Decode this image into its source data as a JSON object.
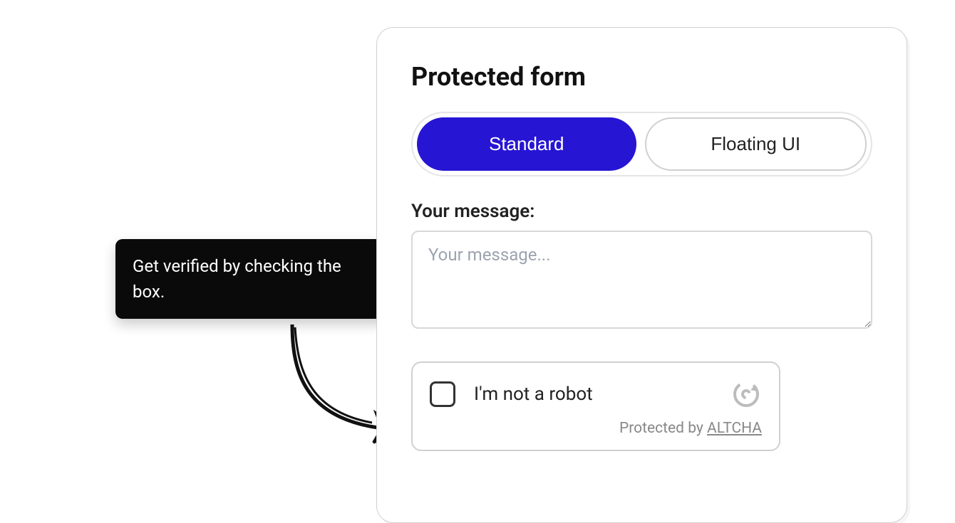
{
  "tooltip": {
    "text": "Get verified by checking the box."
  },
  "form": {
    "title": "Protected form",
    "tabs": [
      {
        "label": "Standard",
        "active": true
      },
      {
        "label": "Floating UI",
        "active": false
      }
    ],
    "message": {
      "label": "Your message:",
      "placeholder": "Your message..."
    },
    "captcha": {
      "label": "I'm not a robot",
      "protected_by_text": "Protected by ",
      "brand": "ALTCHA"
    }
  }
}
